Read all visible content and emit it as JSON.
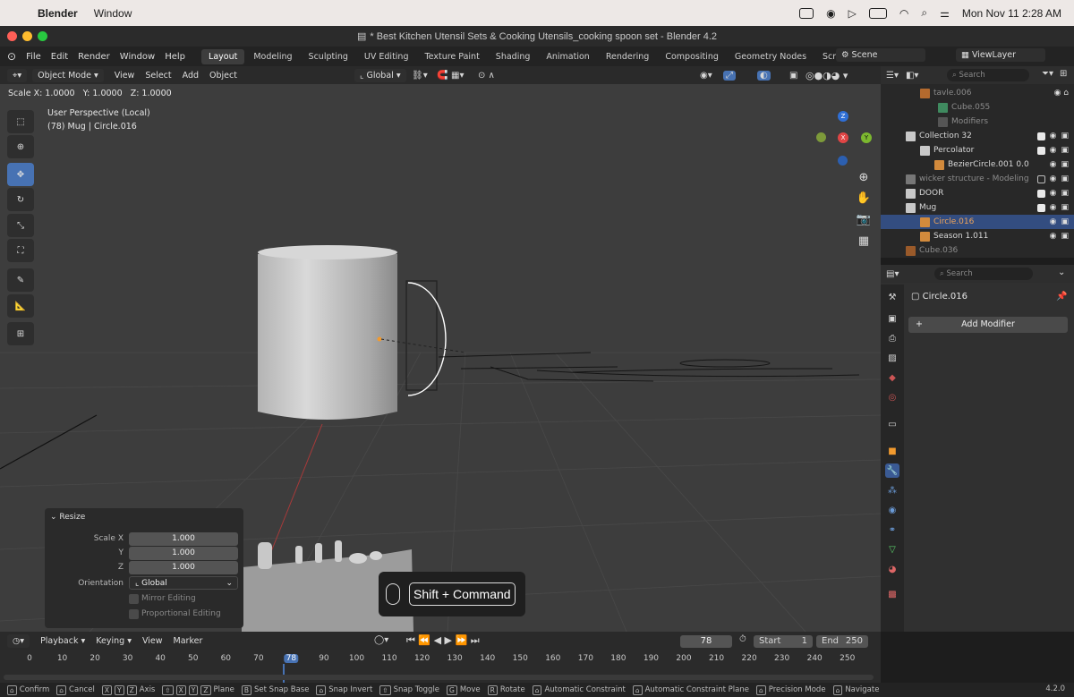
{
  "macos": {
    "app_name": "Blender",
    "menus": [
      "Window"
    ],
    "clock": "Mon Nov 11  2:28 AM"
  },
  "window": {
    "title": "* Best Kitchen Utensil Sets & Cooking Utensils_cooking spoon set - Blender 4.2"
  },
  "topbar": {
    "menus": [
      "File",
      "Edit",
      "Render",
      "Window",
      "Help"
    ],
    "workspaces": [
      "Layout",
      "Modeling",
      "Sculpting",
      "UV Editing",
      "Texture Paint",
      "Shading",
      "Animation",
      "Rendering",
      "Compositing",
      "Geometry Nodes",
      "Scripting"
    ],
    "active_workspace": "Layout",
    "add_tab": "+",
    "scene_label": "Scene",
    "viewlayer_label": "ViewLayer"
  },
  "viewport_header": {
    "mode": "Object Mode",
    "menus": [
      "View",
      "Select",
      "Add",
      "Object"
    ],
    "orientation": "Global"
  },
  "transform_status": {
    "scale_x": "Scale X: 1.0000",
    "scale_y": "Y: 1.0000",
    "scale_z": "Z: 1.0000"
  },
  "viewport": {
    "perspective": "User Perspective (Local)",
    "object_info": "(78) Mug | Circle.016",
    "axes": {
      "z": "Z",
      "x": "X",
      "y": "Y"
    },
    "keystroke_overlay": "Shift + Command"
  },
  "redo_panel": {
    "title": "Resize",
    "scale_x_label": "Scale X",
    "y_label": "Y",
    "z_label": "Z",
    "scale_x": "1.000",
    "scale_y": "1.000",
    "scale_z": "1.000",
    "orientation_label": "Orientation",
    "orientation": "Global",
    "mirror_editing": "Mirror Editing",
    "proportional_editing": "Proportional Editing"
  },
  "outliner": {
    "search_placeholder": "Search",
    "rows": [
      {
        "label": "tavle.006",
        "dim": true
      },
      {
        "label": "Cube.055",
        "dim": true
      },
      {
        "label": "Modifiers",
        "dim": true
      },
      {
        "label": "Collection 32",
        "dim": false
      },
      {
        "label": "Percolator",
        "dim": false
      },
      {
        "label": "BezierCircle.001",
        "extra": "0.0",
        "dim": false
      },
      {
        "label": "wicker structure - Modeling",
        "dim": true
      },
      {
        "label": "DOOR",
        "dim": false
      },
      {
        "label": "Mug",
        "dim": false
      },
      {
        "label": "Circle.016",
        "dim": false,
        "selected": true
      },
      {
        "label": "Season 1.011",
        "dim": false
      },
      {
        "label": "Cube.036",
        "dim": true
      }
    ]
  },
  "properties": {
    "search_placeholder": "Search",
    "object_name": "Circle.016",
    "add_modifier": "Add Modifier"
  },
  "timeline": {
    "menus": [
      "Playback",
      "Keying",
      "View",
      "Marker"
    ],
    "current_frame": "78",
    "start_label": "Start",
    "start": "1",
    "end_label": "End",
    "end": "250",
    "ticks": [
      "0",
      "10",
      "20",
      "30",
      "40",
      "50",
      "60",
      "70",
      "78",
      "90",
      "100",
      "110",
      "120",
      "130",
      "140",
      "150",
      "160",
      "170",
      "180",
      "190",
      "200",
      "210",
      "220",
      "230",
      "240",
      "250"
    ]
  },
  "statusbar": {
    "items": [
      {
        "keys": "",
        "label": "Confirm"
      },
      {
        "keys": "",
        "label": "Cancel"
      },
      {
        "keys": "X Y Z",
        "label": "Axis"
      },
      {
        "keys": "⇧ X Y Z",
        "label": "Plane"
      },
      {
        "keys": "B",
        "label": "Set Snap Base"
      },
      {
        "keys": "",
        "label": "Snap Invert"
      },
      {
        "keys": "⇧",
        "label": "Snap Toggle"
      },
      {
        "keys": "G",
        "label": "Move"
      },
      {
        "keys": "R",
        "label": "Rotate"
      },
      {
        "keys": "",
        "label": "Automatic Constraint"
      },
      {
        "keys": "",
        "label": "Automatic Constraint Plane"
      },
      {
        "keys": "",
        "label": "Precision Mode"
      },
      {
        "keys": "",
        "label": "Navigate"
      }
    ],
    "version": "4.2.0"
  }
}
